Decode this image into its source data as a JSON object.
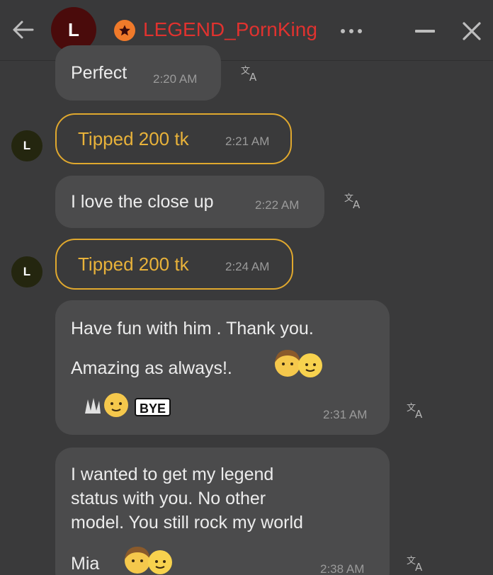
{
  "header": {
    "avatar_letter": "L",
    "username": "LEGEND_PornKing",
    "username_color": "#e0322f",
    "badge_color": "#f07a2a",
    "icons": [
      "arrow-left-icon",
      "star-icon",
      "more-icon",
      "minimize-icon",
      "close-icon"
    ]
  },
  "messages": [
    {
      "type": "text",
      "text": "Perfect",
      "time": "2:20 AM"
    },
    {
      "type": "tip",
      "sender_initial": "L",
      "text": "Tipped 200 tk",
      "time": "2:21 AM"
    },
    {
      "type": "text",
      "text": "I love the close up",
      "time": "2:22 AM"
    },
    {
      "type": "tip",
      "sender_initial": "L",
      "text": "Tipped 200 tk",
      "time": "2:24 AM"
    },
    {
      "type": "text",
      "lines": [
        "Have fun with him . Thank you.",
        "Amazing as always!."
      ],
      "sticker_text": "BYE",
      "time": "2:31 AM"
    },
    {
      "type": "text",
      "lines": [
        "I wanted to get my legend",
        "status with you. No other",
        "model. You still rock my world",
        "Mia"
      ],
      "time": "2:38 AM"
    }
  ],
  "colors": {
    "background": "#3a3a3b",
    "bubble": "#4b4b4c",
    "tip_border": "#e0a82e",
    "tip_text": "#e8b23a"
  }
}
